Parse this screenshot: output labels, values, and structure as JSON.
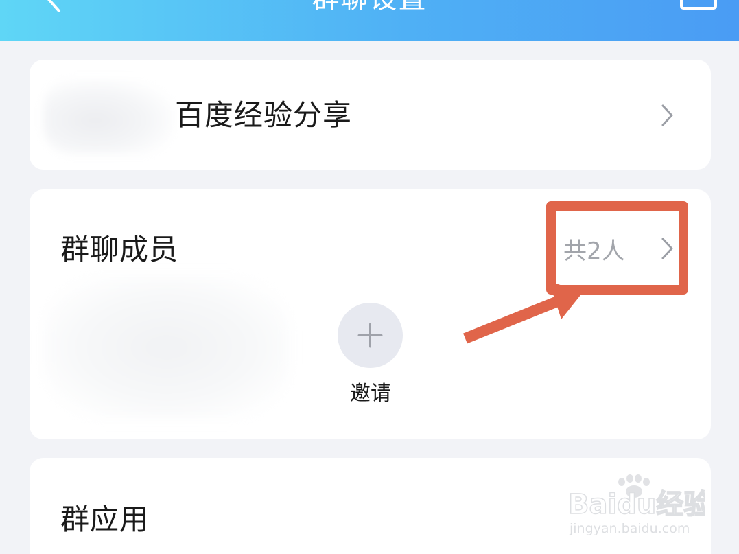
{
  "header": {
    "title": "群聊设置"
  },
  "group": {
    "name": "百度经验分享"
  },
  "members": {
    "title": "群聊成员",
    "count": "共2人",
    "invite_label": "邀请"
  },
  "apps": {
    "title": "群应用"
  },
  "watermark": {
    "brand": "Baidu经验",
    "url": "jingyan.baidu.com"
  },
  "colors": {
    "header_start": "#5fd6f6",
    "header_end": "#4a9cf4",
    "annotation": "#e0654a",
    "muted_text": "#a2a5ab"
  }
}
